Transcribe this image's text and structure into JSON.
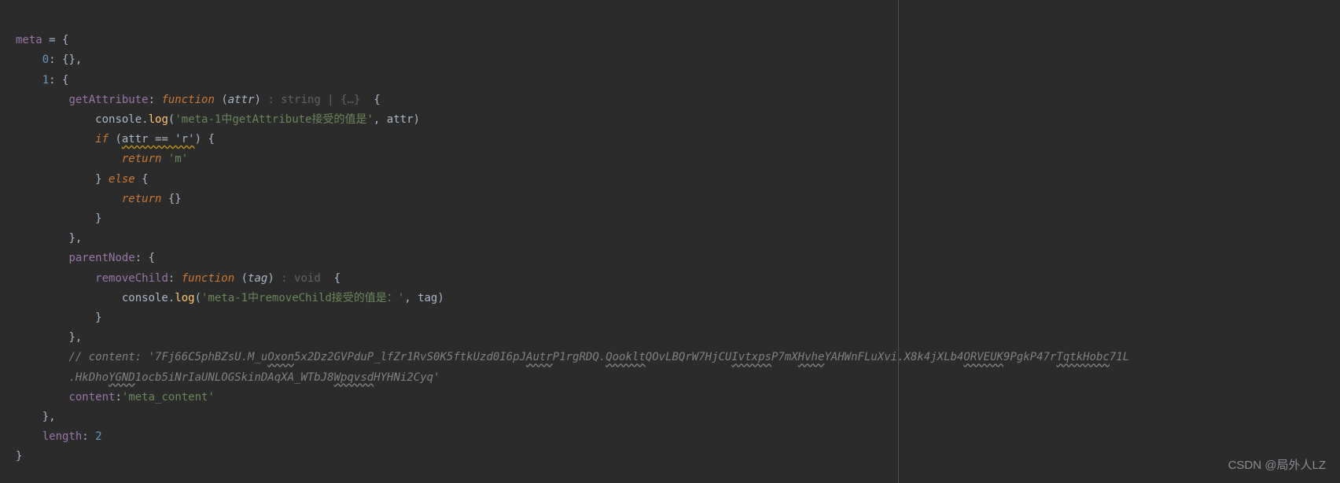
{
  "line1": {
    "var": "meta",
    "op": " = {"
  },
  "line2": {
    "key": "0",
    "rest": ": {},"
  },
  "line3": {
    "key": "1",
    "rest": ": {"
  },
  "line4": {
    "prop": "getAttribute",
    "colon": ": ",
    "kw": "function",
    "open": " (",
    "param": "attr",
    "close": ") ",
    "hint": ": string | {…} ",
    "brace": " {"
  },
  "line5": {
    "obj": "console",
    "dot": ".",
    "fn": "log",
    "open": "(",
    "str": "'meta-1中getAttribute接受的值是'",
    "comma": ", ",
    "arg": "attr",
    "close": ")"
  },
  "line6": {
    "kw": "if",
    "open": " (",
    "cond": "attr == 'r'",
    "close": ") {"
  },
  "line7": {
    "kw": "return",
    "sp": " ",
    "val": "'m'"
  },
  "line8": {
    "txt": "} ",
    "kw": "else",
    "rest": " {"
  },
  "line9": {
    "kw": "return",
    "rest": " {}"
  },
  "line10": {
    "txt": "}"
  },
  "line11": {
    "txt": "},"
  },
  "line12": {
    "prop": "parentNode",
    "rest": ": {"
  },
  "line13": {
    "prop": "removeChild",
    "colon": ": ",
    "kw": "function",
    "open": " (",
    "param": "tag",
    "close": ") ",
    "hint": ": void ",
    "brace": " {"
  },
  "line14": {
    "obj": "console",
    "dot": ".",
    "fn": "log",
    "open": "(",
    "str": "'meta-1中removeChild接受的值是：'",
    "comma": ", ",
    "arg": "tag",
    "close": ")"
  },
  "line15": {
    "txt": "}"
  },
  "line16": {
    "txt": "},"
  },
  "line17a": "// content: '7Fj66C5phBZsU.M_u",
  "line17b": "Oxon",
  "line17c": "5x2Dz2GVPduP_lfZr1RvS0K5ftkUzd0I6pJ",
  "line17d": "Autr",
  "line17e": "P1rgRDQ.",
  "line17f": "Qooklt",
  "line17g": "QOvLBQrW7HjCU",
  "line17h": "Ivtxps",
  "line17i": "P7mX",
  "line17j": "Hvhe",
  "line17k": "YAHWnFLuXvi.X8k4jXLb4",
  "line17l": "ORVEUK",
  "line17m": "9PgkP47r",
  "line17n": "TqtkHobc",
  "line17o": "71L",
  "line18a": ".HkDho",
  "line18b": "YGND",
  "line18c": "1ocb5iNrIaUNLOGSkinDAqXA_WTbJ8",
  "line18d": "Wpqvsd",
  "line18e": "HYHNi2Cyq'",
  "line19": {
    "prop": "content",
    "colon": ":",
    "val": "'meta_content'"
  },
  "line20": {
    "txt": "},"
  },
  "line21": {
    "prop": "length",
    "colon": ": ",
    "val": "2"
  },
  "line22": {
    "txt": "}"
  },
  "watermark": "CSDN @局外人LZ"
}
